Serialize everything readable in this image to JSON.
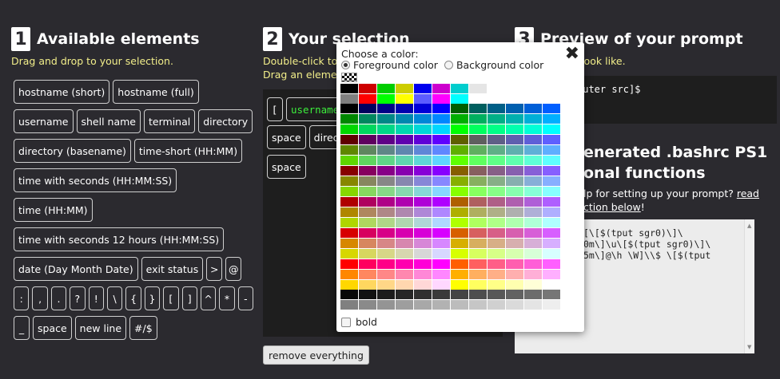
{
  "steps": [
    {
      "num": "1",
      "title": "Available elements",
      "hints": [
        "Drag and drop to your selection."
      ]
    },
    {
      "num": "2",
      "title": "Your selection",
      "hints": [
        "Double-click to",
        "Drag an element"
      ]
    },
    {
      "num": "3",
      "title": "Preview of your prompt",
      "hints": [
        "r prompt will look like."
      ]
    }
  ],
  "elements": [
    [
      "hostname (short)",
      "hostname (full)"
    ],
    [
      "username",
      "shell name",
      "terminal",
      "directory"
    ],
    [
      "directory (basename)",
      "time-short (HH:MM)"
    ],
    [
      "time with seconds (HH:MM:SS)"
    ],
    [
      "time (HH:MM)"
    ],
    [
      "time with seconds 12 hours (HH:MM:SS)"
    ],
    [
      "date (Day Month Date)",
      "exit status",
      ">",
      "@"
    ],
    [
      ":",
      ",",
      ".",
      "?",
      "!",
      "\\",
      "{",
      "}",
      "[",
      "]",
      "^",
      "*",
      "-"
    ],
    [
      "_",
      "space",
      "new line",
      "#/$"
    ]
  ],
  "selection": {
    "row1": [
      "[",
      "username"
    ],
    "row2": [
      "space",
      "direct"
    ],
    "row3": [
      "space"
    ]
  },
  "remove_label": "remove everything",
  "preview_text": "puter src]$",
  "bashrc_title": "enerated .bashrc PS1\nonal functions",
  "help_text": "lp for setting up your prompt? ",
  "help_link": "read",
  "help_link2": "ction below",
  "help_end": "!",
  "code_text": "[\\[$(tput sgr0)\\]\\\n0m\\]\\u\\[$(tput sgr0)\\]\\\n5m\\]@\\h \\W]\\\\$ \\[$(tput",
  "picker": {
    "heading": "Choose a color:",
    "foreground_label": "Foreground color",
    "background_label": "Background color",
    "foreground_selected": true,
    "bold_label": "bold",
    "bold_checked": false,
    "close_icon": "close-icon"
  }
}
